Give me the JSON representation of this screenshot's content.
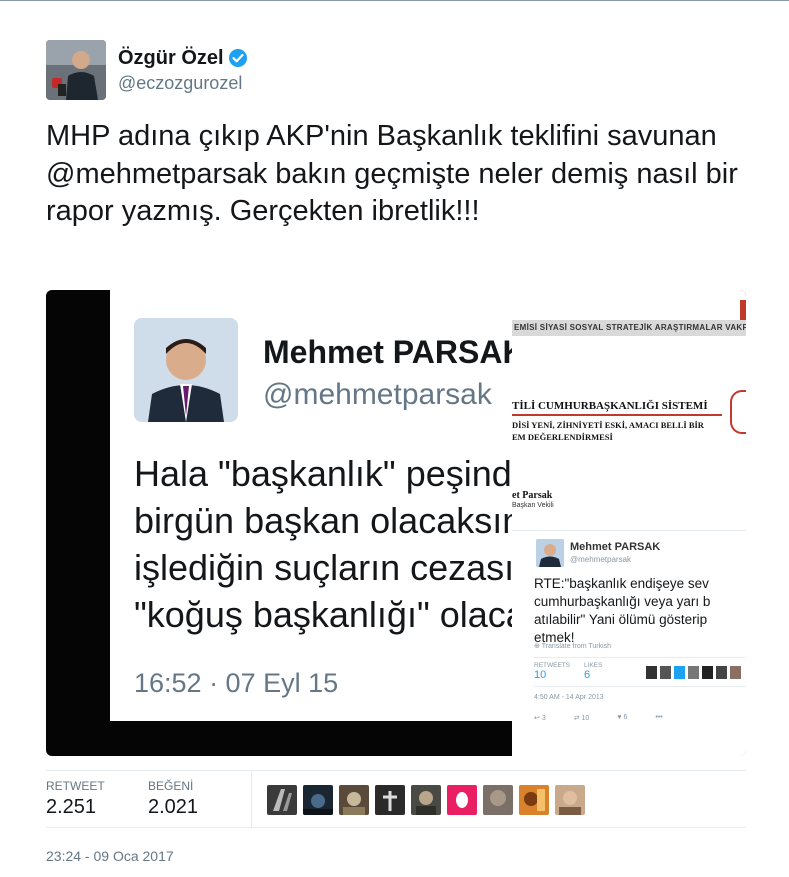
{
  "author": {
    "display_name": "Özgür Özel",
    "handle": "@eczozgurozel",
    "verified": true
  },
  "tweet": {
    "text_part1": "MHP adına çıkıp AKP'nin Başkanlık teklifini savunan ",
    "mention": "@mehmetparsak",
    "text_part2": " bakın geçmişte neler demiş nasıl bir rapor yazmış. Gerçekten ibretlik!!!"
  },
  "media": {
    "left_card": {
      "name": "Mehmet PARSAK",
      "handle": "@mehmetparsak",
      "text": "Hala \"başkanlık\" peşinde\nbirgün başkan olacaksın\nişlediğin suçların cezası\n\"koğuş başkanlığı\" olacak",
      "time": "16:52 · 07 Eyl 15"
    },
    "report": {
      "bar_text": "EMİSİ SİYASİ SOSYAL STRATEJİK ARAŞTIRMALAR VAKFI",
      "title": "TİLİ CUMHURBAŞKANLIĞI SİSTEMİ",
      "sub1": "DİSİ YENİ, ZİHNİYETİ ESKİ, AMACI BELLİ BİR",
      "sub2": "EM DEĞERLENDİRMESİ",
      "author": "et Parsak",
      "role": "Başkan Vekili"
    },
    "mini_tweet": {
      "name": "Mehmet PARSAK",
      "handle": "@mehmetparsak",
      "text": "RTE:\"başkanlık endişeye sev\ncumhurbaşkanlığı veya yarı b\natılabilir\" Yani ölümü gösterip\netmek!",
      "translate": "Translate from Turkish",
      "retweets_label": "RETWEETS",
      "retweets": "10",
      "likes_label": "LIKES",
      "likes": "6",
      "date": "4:50 AM - 14 Apr 2013",
      "reply_count": "3",
      "retweet_count": "10",
      "like_count": "6",
      "more": "•••"
    }
  },
  "stats": {
    "retweet_label": "RETWEET",
    "retweet_value": "2.251",
    "like_label": "BEĞENİ",
    "like_value": "2.021"
  },
  "timestamp": "23:24 - 09 Oca 2017",
  "colors": {
    "verified": "#1da1f2",
    "text_primary": "#14171a",
    "text_secondary": "#657786",
    "accent_red": "#c0392b"
  }
}
